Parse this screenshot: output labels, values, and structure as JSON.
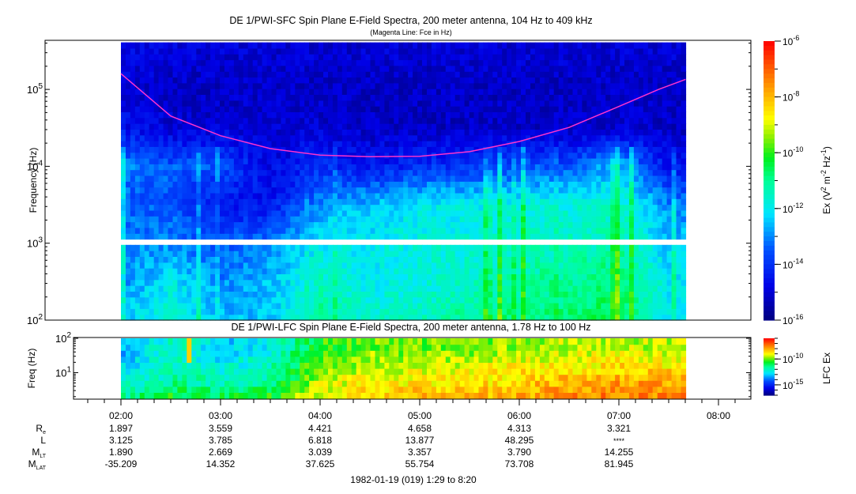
{
  "chart_data": [
    {
      "type": "heatmap",
      "title": "DE 1/PWI-SFC  Spin Plane E-Field Spectra, 200 meter antenna, 104 Hz to 409 kHz",
      "subtitle": "(Magenta Line: Fce in Hz)",
      "ylabel": "Frequency (Hz)",
      "yscale": "log",
      "ylim": [
        100,
        409000
      ],
      "yticks": [
        {
          "v": 100,
          "base": "10",
          "exp": "2"
        },
        {
          "v": 1000,
          "base": "10",
          "exp": "3"
        },
        {
          "v": 10000,
          "base": "10",
          "exp": "4"
        },
        {
          "v": 100000,
          "base": "10",
          "exp": "5"
        }
      ],
      "time_hours": [
        2.0,
        2.5,
        3.0,
        3.5,
        4.0,
        4.5,
        5.0,
        5.5,
        6.0,
        6.5,
        7.0,
        7.5
      ],
      "log10_freq_rows": [
        2.0,
        2.5,
        3.0,
        3.5,
        4.0,
        4.5,
        5.0,
        5.6
      ],
      "log10_intensity": [
        [
          -12.5,
          -11.5,
          -12.5,
          -12.5,
          -11.0,
          -11.5,
          -11.5,
          -11.0,
          -10.8,
          -10.8,
          -10.5,
          -12.0
        ],
        [
          -13.0,
          -12.0,
          -13.0,
          -12.5,
          -11.5,
          -12.0,
          -11.8,
          -11.5,
          -11.2,
          -11.0,
          -10.8,
          -12.0
        ],
        [
          -13.0,
          -13.0,
          -13.5,
          -13.0,
          -12.0,
          -12.0,
          -11.8,
          -11.8,
          -11.5,
          -11.5,
          -11.2,
          -12.5
        ],
        [
          -13.5,
          -13.5,
          -14.5,
          -14.5,
          -13.0,
          -12.5,
          -12.0,
          -12.0,
          -11.8,
          -11.8,
          -11.5,
          -13.0
        ],
        [
          -13.0,
          -13.5,
          -13.5,
          -14.8,
          -14.0,
          -14.5,
          -14.0,
          -14.0,
          -13.5,
          -13.5,
          -12.5,
          -14.5
        ],
        [
          -14.5,
          -15.0,
          -15.0,
          -15.0,
          -15.0,
          -15.2,
          -15.2,
          -15.2,
          -15.2,
          -15.2,
          -15.0,
          -15.2
        ],
        [
          -15.0,
          -15.2,
          -15.2,
          -15.2,
          -15.2,
          -15.2,
          -15.2,
          -15.2,
          -15.2,
          -15.2,
          -15.2,
          -15.2
        ],
        [
          -14.8,
          -14.8,
          -15.0,
          -15.0,
          -15.0,
          -15.0,
          -15.0,
          -15.0,
          -15.0,
          -15.0,
          -15.0,
          -15.0
        ]
      ],
      "data_time_range_hours": [
        2.0,
        7.67
      ],
      "fce_line": {
        "color": "#ff33cc",
        "time_hours": [
          2.0,
          2.5,
          3.0,
          3.5,
          4.0,
          4.5,
          5.0,
          5.5,
          6.0,
          6.5,
          7.0,
          7.4,
          7.67
        ],
        "freq_hz": [
          160000,
          45000,
          25000,
          17000,
          14000,
          13300,
          13500,
          15500,
          21000,
          32000,
          60000,
          100000,
          135000
        ]
      },
      "colorbar": {
        "label_pre": "Ex (V",
        "label_sup1": "2",
        "label_mid": " m",
        "label_sup2": "-2",
        "label_mid2": " Hz",
        "label_sup3": "-1",
        "label_post": ")",
        "range_log10": [
          -16,
          -6
        ],
        "ticks": [
          {
            "v": -6,
            "base": "10",
            "exp": "-6"
          },
          {
            "v": -8,
            "base": "10",
            "exp": "-8"
          },
          {
            "v": -10,
            "base": "10",
            "exp": "-10"
          },
          {
            "v": -12,
            "base": "10",
            "exp": "-12"
          },
          {
            "v": -14,
            "base": "10",
            "exp": "-14"
          },
          {
            "v": -16,
            "base": "10",
            "exp": "-16"
          }
        ]
      }
    },
    {
      "type": "heatmap",
      "title": "DE 1/PWI-LFC  Spin Plane E-Field Spectra, 200 meter antenna, 1.78 Hz to 100 Hz",
      "ylabel": "Freq (Hz)",
      "yscale": "log",
      "ylim": [
        1.78,
        100
      ],
      "yticks": [
        {
          "v": 10,
          "base": "10",
          "exp": "1"
        },
        {
          "v": 100,
          "base": "10",
          "exp": "2"
        }
      ],
      "time_hours": [
        2.0,
        2.5,
        3.0,
        3.5,
        4.0,
        4.5,
        5.0,
        5.5,
        6.0,
        6.5,
        7.0,
        7.5
      ],
      "log10_freq_rows": [
        0.25,
        0.75,
        1.25,
        1.75,
        2.0
      ],
      "log10_intensity": [
        [
          -11.5,
          -10.5,
          -11.0,
          -10.5,
          -9.0,
          -8.5,
          -8.0,
          -8.0,
          -8.0,
          -7.5,
          -7.5,
          -7.5
        ],
        [
          -12.5,
          -11.5,
          -12.0,
          -11.5,
          -9.5,
          -9.0,
          -8.8,
          -8.8,
          -8.5,
          -8.2,
          -8.0,
          -8.0
        ],
        [
          -13.0,
          -12.0,
          -12.5,
          -12.0,
          -10.0,
          -9.5,
          -9.5,
          -9.3,
          -9.0,
          -9.0,
          -8.8,
          -8.8
        ],
        [
          -13.5,
          -12.0,
          -13.0,
          -12.5,
          -10.5,
          -10.0,
          -10.0,
          -10.0,
          -9.8,
          -9.5,
          -9.5,
          -9.5
        ],
        [
          -13.5,
          -12.0,
          -13.0,
          -12.5,
          -10.5,
          -10.0,
          -10.0,
          -10.0,
          -9.8,
          -9.5,
          -9.5,
          -9.5
        ]
      ],
      "colorbar": {
        "label": "LFC Ex",
        "range_log10": [
          -17,
          -6
        ],
        "ticks": [
          {
            "v": -10,
            "base": "10",
            "exp": "-10"
          },
          {
            "v": -15,
            "base": "10",
            "exp": "-15"
          }
        ]
      }
    }
  ],
  "time_axis": {
    "ticks": [
      "02:00",
      "03:00",
      "04:00",
      "05:00",
      "06:00",
      "07:00",
      "08:00"
    ],
    "tick_hours": [
      2,
      3,
      4,
      5,
      6,
      7,
      8
    ],
    "range_hours": [
      1.52,
      8.3
    ]
  },
  "ephemeris": {
    "rows": [
      {
        "label": "R",
        "sub": "e",
        "values": [
          "1.897",
          "3.559",
          "4.421",
          "4.658",
          "4.313",
          "3.321"
        ]
      },
      {
        "label": "L",
        "sub": "",
        "values": [
          "3.125",
          "3.785",
          "6.818",
          "13.877",
          "48.295",
          "****"
        ]
      },
      {
        "label": "M",
        "sub": "LT",
        "values": [
          "1.890",
          "2.669",
          "3.039",
          "3.357",
          "3.790",
          "14.255"
        ]
      },
      {
        "label": "M",
        "sub": "LAT",
        "values": [
          "-35.209",
          "14.352",
          "37.625",
          "55.754",
          "73.708",
          "81.945"
        ]
      }
    ]
  },
  "footer": "1982-01-19 (019) 1:29 to 8:20"
}
